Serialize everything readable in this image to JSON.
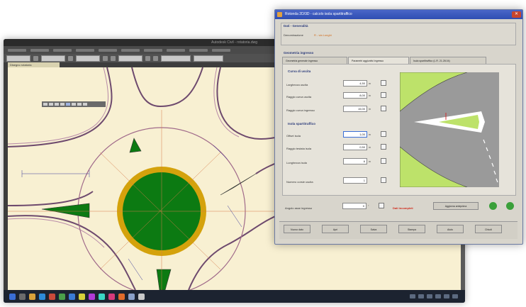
{
  "cad_window": {
    "title": "Autodesk Civil - rotatoria.dwg",
    "drawing_tab": "Disegno rotatoria",
    "toolbar_fields": [
      "Layer 0",
      "ByLayer",
      "ByLayer",
      "Standard"
    ]
  },
  "dialog": {
    "title": "Rotonda 2D/3D - calcolo isola spartitraffico",
    "header_group": {
      "title": "Dati - Generalità",
      "label": "Denominazione",
      "value": "R - via Longhi"
    },
    "section_title": "Geometria ingresso",
    "tabs": [
      "Geometria generale ingresso",
      "Parametri aggiuntivi ingresso",
      "Isola spartitraffico (L.R. 21.28.04)"
    ],
    "curve_group": {
      "title": "Curva di uscita",
      "fields": [
        {
          "label": "Larghezza uscita",
          "value": "4,50",
          "unit": "m"
        },
        {
          "label": "Raggio curva uscita",
          "value": "8,00",
          "unit": "m"
        },
        {
          "label": "Raggio curva ingresso",
          "value": "15,00",
          "unit": "m"
        }
      ]
    },
    "island_group": {
      "title": "Isola spartitraffico",
      "fields": [
        {
          "label": "Offset isola",
          "value": "1,00",
          "unit": "m"
        },
        {
          "label": "Raggio testata isola",
          "value": "0,50",
          "unit": "m"
        },
        {
          "label": "Lunghezza isola",
          "value": "6",
          "unit": "m"
        }
      ]
    },
    "bottom_field": {
      "label": "Numero corsie uscita",
      "value": "1"
    },
    "angle_field": {
      "label": "Angolo asse ingresso",
      "value": "0",
      "unit": "°"
    },
    "warning_text": "Dati incompleti",
    "action_button": "Aggiorna anteprima",
    "footer_buttons": [
      "Nuovo dato",
      "Apri",
      "Salva",
      "Stampa",
      "Aiuto",
      "Chiudi"
    ]
  },
  "colors": {
    "island_green": "#0c7a12",
    "ring_yellow": "#d4a20c",
    "lane_gray": "#9a9a9a",
    "light_green": "#bde26a"
  }
}
